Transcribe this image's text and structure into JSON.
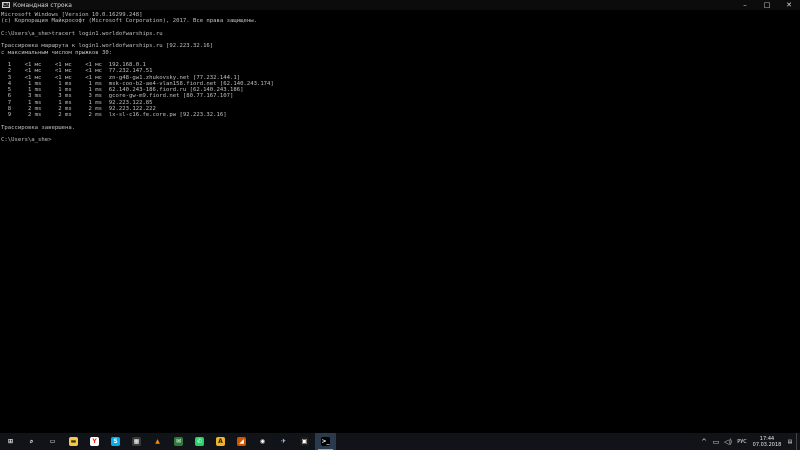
{
  "window": {
    "title": "Командная строка",
    "icon_label": "C:\\"
  },
  "console_lines": [
    "Microsoft Windows [Version 10.0.16299.248]",
    "(c) Корпорация Майкрософт (Microsoft Corporation), 2017. Все права защищены.",
    "",
    "C:\\Users\\a_she>tracert login1.worldofwarships.ru",
    "",
    "Трассировка маршрута к login1.worldofwarships.ru [92.223.32.16]",
    "с максимальным числом прыжков 30:",
    "",
    "  1    <1 мс    <1 мс    <1 мс  192.168.0.1",
    "  2    <1 мс    <1 мс    <1 мс  77.232.147.51",
    "  3    <1 мс    <1 мс    <1 мс  zn-g48-gw1.zhukovsky.net [77.232.144.1]",
    "  4     1 ms     1 ms     1 ms  msk-coo-b2-ae4-vlan158.fiord.net [62.140.243.174]",
    "  5     1 ms     1 ms     1 ms  62.140.243-186.fiord.ru [62.140.243.186]",
    "  6     3 ms     3 ms     3 ms  gcore-gw-m9.fiord.net [80.77.167.107]",
    "  7     1 ms     1 ms     1 ms  92.223.122.85",
    "  8     2 ms     2 ms     2 ms  92.223.122.222",
    "  9     2 ms     2 ms     2 ms  lx-sl-c16.fe.core.pw [92.223.32.16]",
    "",
    "Трассировка завершена.",
    "",
    "C:\\Users\\a_she>"
  ],
  "taskbar": {
    "apps": [
      {
        "name": "windows-start-icon",
        "glyph": "⊞",
        "color": "#ffffff",
        "bg": "transparent"
      },
      {
        "name": "search-icon",
        "glyph": "⌕",
        "color": "#ffffff",
        "bg": "transparent"
      },
      {
        "name": "task-view-icon",
        "glyph": "▭",
        "color": "#ffffff",
        "bg": "transparent"
      },
      {
        "name": "file-explorer-icon",
        "glyph": "▬",
        "color": "#3a2b00",
        "bg": "#f2c94c"
      },
      {
        "name": "yandex-browser-icon",
        "glyph": "Y",
        "color": "#e8231b",
        "bg": "#ffffff"
      },
      {
        "name": "skype-icon",
        "glyph": "S",
        "color": "#ffffff",
        "bg": "#00aff0"
      },
      {
        "name": "calculator-icon",
        "glyph": "▦",
        "color": "#ffffff",
        "bg": "#3a3a3a"
      },
      {
        "name": "vlc-icon",
        "glyph": "▲",
        "color": "#ff8800",
        "bg": "transparent"
      },
      {
        "name": "hexchat-icon",
        "glyph": "✉",
        "color": "#ffffff",
        "bg": "#2f7a3a"
      },
      {
        "name": "whatsapp-icon",
        "glyph": "✆",
        "color": "#ffffff",
        "bg": "#25d366"
      },
      {
        "name": "aimp-icon",
        "glyph": "A",
        "color": "#2a1a00",
        "bg": "#f0b429"
      },
      {
        "name": "game-launcher-icon",
        "glyph": "◢",
        "color": "#ffffff",
        "bg": "#d35400"
      },
      {
        "name": "steam-icon",
        "glyph": "◉",
        "color": "#ffffff",
        "bg": "transparent"
      },
      {
        "name": "world-of-warships-icon",
        "glyph": "✈",
        "color": "#cfe3ff",
        "bg": "transparent"
      },
      {
        "name": "media-player-icon",
        "glyph": "▣",
        "color": "#ffffff",
        "bg": "#1c1c1c"
      },
      {
        "name": "command-prompt-icon",
        "glyph": ">_",
        "color": "#ffffff",
        "bg": "#000000",
        "active": true
      }
    ],
    "tray": {
      "show_hidden_icon": "^",
      "network_icon": "▭",
      "volume_icon": "◁)",
      "language": "РУС",
      "time": "17:44",
      "date": "07.03.2018",
      "notification_icon": "▤"
    }
  }
}
